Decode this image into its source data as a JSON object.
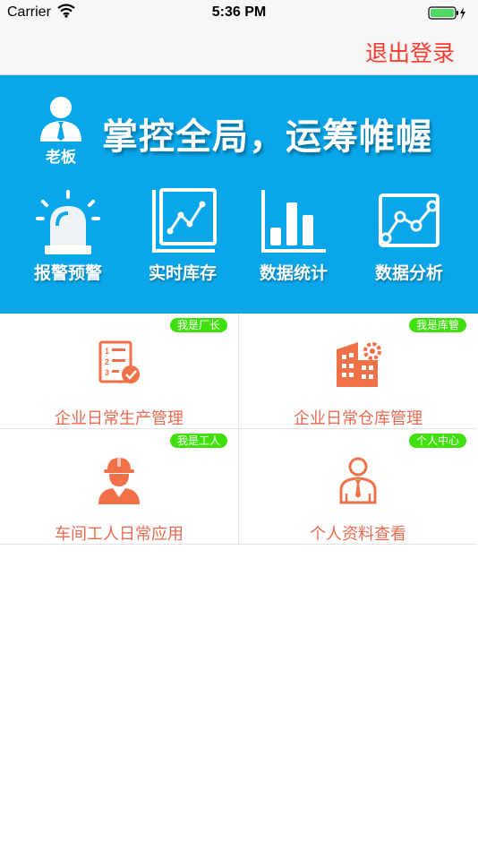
{
  "status_bar": {
    "carrier": "Carrier",
    "time": "5:36 PM"
  },
  "nav": {
    "logout_label": "退出登录"
  },
  "banner": {
    "role_label": "老板",
    "slogan": "掌控全局，运筹帷幄",
    "features": [
      {
        "label": "报警预警",
        "icon": "alarm-siren-icon"
      },
      {
        "label": "实时库存",
        "icon": "line-chart-icon"
      },
      {
        "label": "数据统计",
        "icon": "bar-chart-icon"
      },
      {
        "label": "数据分析",
        "icon": "scatter-chart-icon"
      }
    ]
  },
  "modules": [
    {
      "badge": "我是厂长",
      "label": "企业日常生产管理",
      "icon": "checklist-icon"
    },
    {
      "badge": "我是库管",
      "label": "企业日常仓库管理",
      "icon": "warehouse-gear-icon"
    },
    {
      "badge": "我是工人",
      "label": "车间工人日常应用",
      "icon": "worker-helmet-icon"
    },
    {
      "badge": "个人中心",
      "label": "个人资料查看",
      "icon": "person-tie-icon"
    }
  ],
  "colors": {
    "banner": "#0aa6ea",
    "logout": "#ff3b30",
    "badge": "#3fe00e",
    "module_text": "#ec6a4f",
    "icon_orange": "#f07048"
  }
}
